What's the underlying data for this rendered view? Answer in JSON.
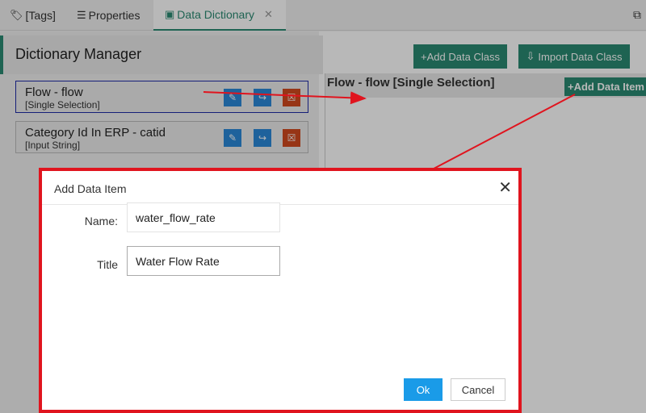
{
  "tabs": [
    {
      "label": "[Tags]",
      "icon": "tag-icon"
    },
    {
      "label": "Properties",
      "icon": "list-icon"
    },
    {
      "label": "Data Dictionary",
      "icon": "book-icon",
      "active": true
    }
  ],
  "header": {
    "title": "Dictionary Manager"
  },
  "toolbar": {
    "add_class_label": "+Add Data Class",
    "import_label": "Import Data Class"
  },
  "classes": [
    {
      "name": "Flow - flow",
      "type": "[Single Selection]",
      "selected": true
    },
    {
      "name": "Category Id In ERP - catid",
      "type": "[Input String]"
    }
  ],
  "right": {
    "title": "Flow - flow [Single Selection]",
    "add_item_label": "+Add Data Item"
  },
  "dialog": {
    "title": "Add Data Item",
    "name_label": "Name:",
    "name_value": "water_flow_rate",
    "title_label": "Title",
    "title_value": "Water Flow Rate",
    "ok_label": "Ok",
    "cancel_label": "Cancel"
  },
  "colors": {
    "accent": "#2a8a72",
    "edit": "#2a88d8",
    "delete": "#d24a1f",
    "ok": "#1a9be8",
    "annotation": "#e0141e"
  }
}
